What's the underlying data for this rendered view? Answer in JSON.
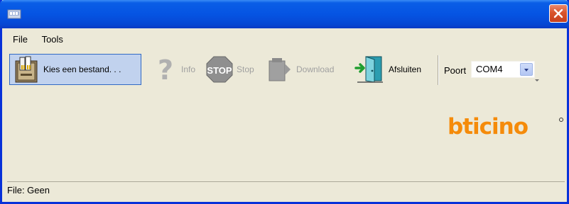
{
  "window": {
    "title": ""
  },
  "menu": {
    "items": [
      "File",
      "Tools"
    ]
  },
  "toolbar": {
    "choose_file_label": "Kies een bestand. . .",
    "info_label": "Info",
    "stop_icon_text": "STOP",
    "stop_label": "Stop",
    "download_label": "Download",
    "quit_label": "Afsluiten",
    "port_label": "Poort",
    "port_value": "COM4"
  },
  "brand": {
    "logo_text": "bticino",
    "color": "#f58b0a"
  },
  "status": {
    "text": "File: Geen"
  },
  "colors": {
    "titlebar": "#0554e3",
    "window_bg": "#ece9d8",
    "close": "#d9542c",
    "selection": "#c1d2ee"
  }
}
